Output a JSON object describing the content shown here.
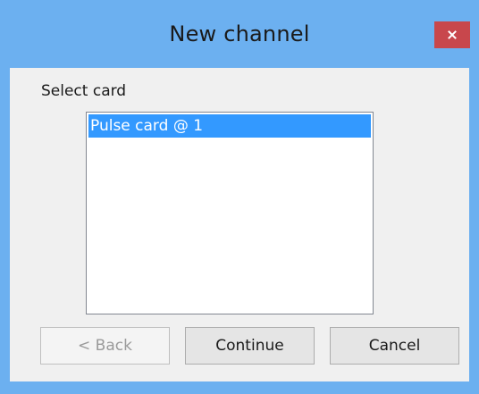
{
  "window": {
    "title": "New channel",
    "close_icon": "close-icon",
    "accent_color": "#6cb0f0",
    "close_color": "#c8474c"
  },
  "dialog": {
    "select_label": "Select card",
    "cards": [
      {
        "label": "Pulse card @ 1",
        "selected": true
      }
    ],
    "selection_color": "#3399ff"
  },
  "buttons": {
    "back_label": "< Back",
    "back_enabled": false,
    "continue_label": "Continue",
    "cancel_label": "Cancel"
  }
}
